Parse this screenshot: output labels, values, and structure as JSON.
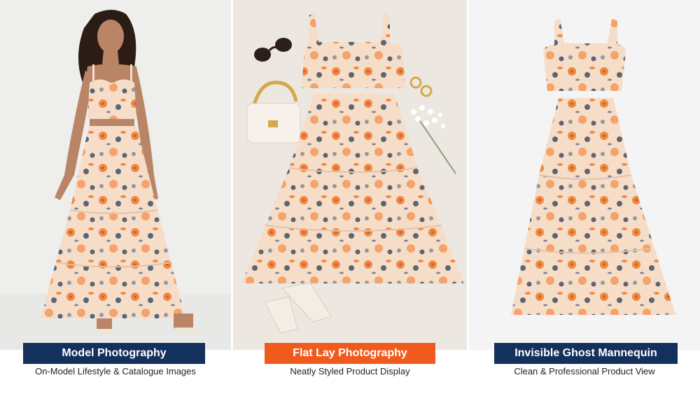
{
  "panels": [
    {
      "title": "Model Photography",
      "subtitle": "On-Model Lifestyle & Catalogue Images",
      "label_color": "#13315c"
    },
    {
      "title": "Flat Lay Photography",
      "subtitle": "Neatly Styled Product Display",
      "label_color": "#f15a1d"
    },
    {
      "title": "Invisible Ghost Mannequin",
      "subtitle": "Clean & Professional Product View",
      "label_color": "#13315c"
    }
  ],
  "colors": {
    "fabric_base": "#f6ddc8",
    "flower_orange": "#ef8a44",
    "flower_slate": "#5c6573",
    "bg_left": "#eeeeed",
    "bg_middle": "#ece7e1",
    "bg_right": "#f4f4f4"
  }
}
